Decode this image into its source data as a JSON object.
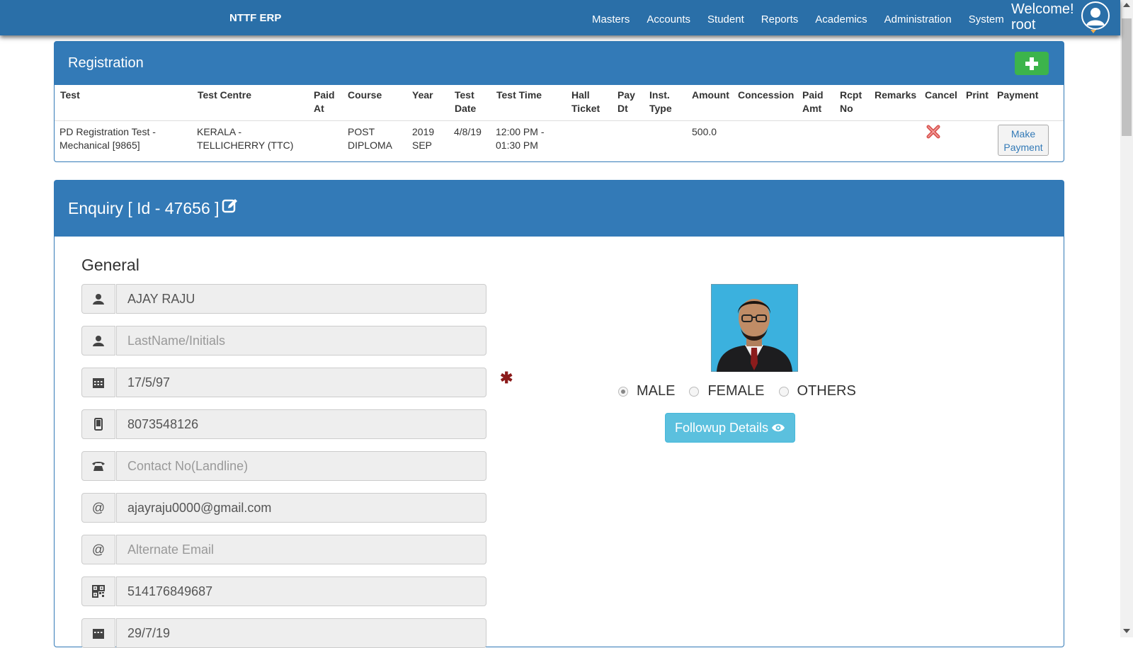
{
  "brand": "NTTF ERP",
  "nav": [
    "Masters",
    "Accounts",
    "Student",
    "Reports",
    "Academics",
    "Administration",
    "System"
  ],
  "welcome": {
    "line1": "Welcome!",
    "line2": "root"
  },
  "registration": {
    "title": "Registration",
    "add_icon": "plus-icon",
    "headers": [
      "Test",
      "Test Centre",
      "Paid At",
      "Course",
      "Year",
      "Test Date",
      "Test Time",
      "Hall Ticket",
      "Pay Dt",
      "Inst. Type",
      "Amount",
      "Concession",
      "Paid Amt",
      "Rcpt No",
      "Remarks",
      "Cancel",
      "Print",
      "Payment"
    ],
    "row": {
      "test": "PD Registration Test - Mechanical [9865]",
      "test_centre": "KERALA - TELLICHERRY (TTC)",
      "course": "POST DIPLOMA",
      "year": "2019 SEP",
      "test_date": "4/8/19",
      "test_time": "12:00 PM - 01:30 PM",
      "amount": "500.0",
      "payment_button": "Make Payment"
    }
  },
  "enquiry": {
    "title": "Enquiry [ Id - 47656 ]",
    "section": "General",
    "fields": [
      {
        "icon": "user-icon",
        "value": "AJAY RAJU",
        "placeholder": ""
      },
      {
        "icon": "user-icon",
        "value": "",
        "placeholder": "LastName/Initials"
      },
      {
        "icon": "calendar-icon",
        "value": "17/5/97",
        "placeholder": ""
      },
      {
        "icon": "mobile-icon",
        "value": "8073548126",
        "placeholder": ""
      },
      {
        "icon": "phone-icon",
        "value": "",
        "placeholder": "Contact No(Landline)"
      },
      {
        "icon": "at-icon",
        "value": "ajayraju0000@gmail.com",
        "placeholder": ""
      },
      {
        "icon": "at-icon",
        "value": "",
        "placeholder": "Alternate Email"
      },
      {
        "icon": "qrcode-icon",
        "value": "514176849687",
        "placeholder": ""
      },
      {
        "icon": "calendar-icon",
        "value": "29/7/19",
        "placeholder": ""
      }
    ],
    "gender_options": [
      "MALE",
      "FEMALE",
      "OTHERS"
    ],
    "gender_selected": "MALE",
    "followup_button": "Followup Details"
  },
  "colors": {
    "header": "#2a6fa8",
    "panel": "#337ab7",
    "add": "#3cb44b",
    "followup": "#5bc0de",
    "required": "#8b1a1a"
  }
}
